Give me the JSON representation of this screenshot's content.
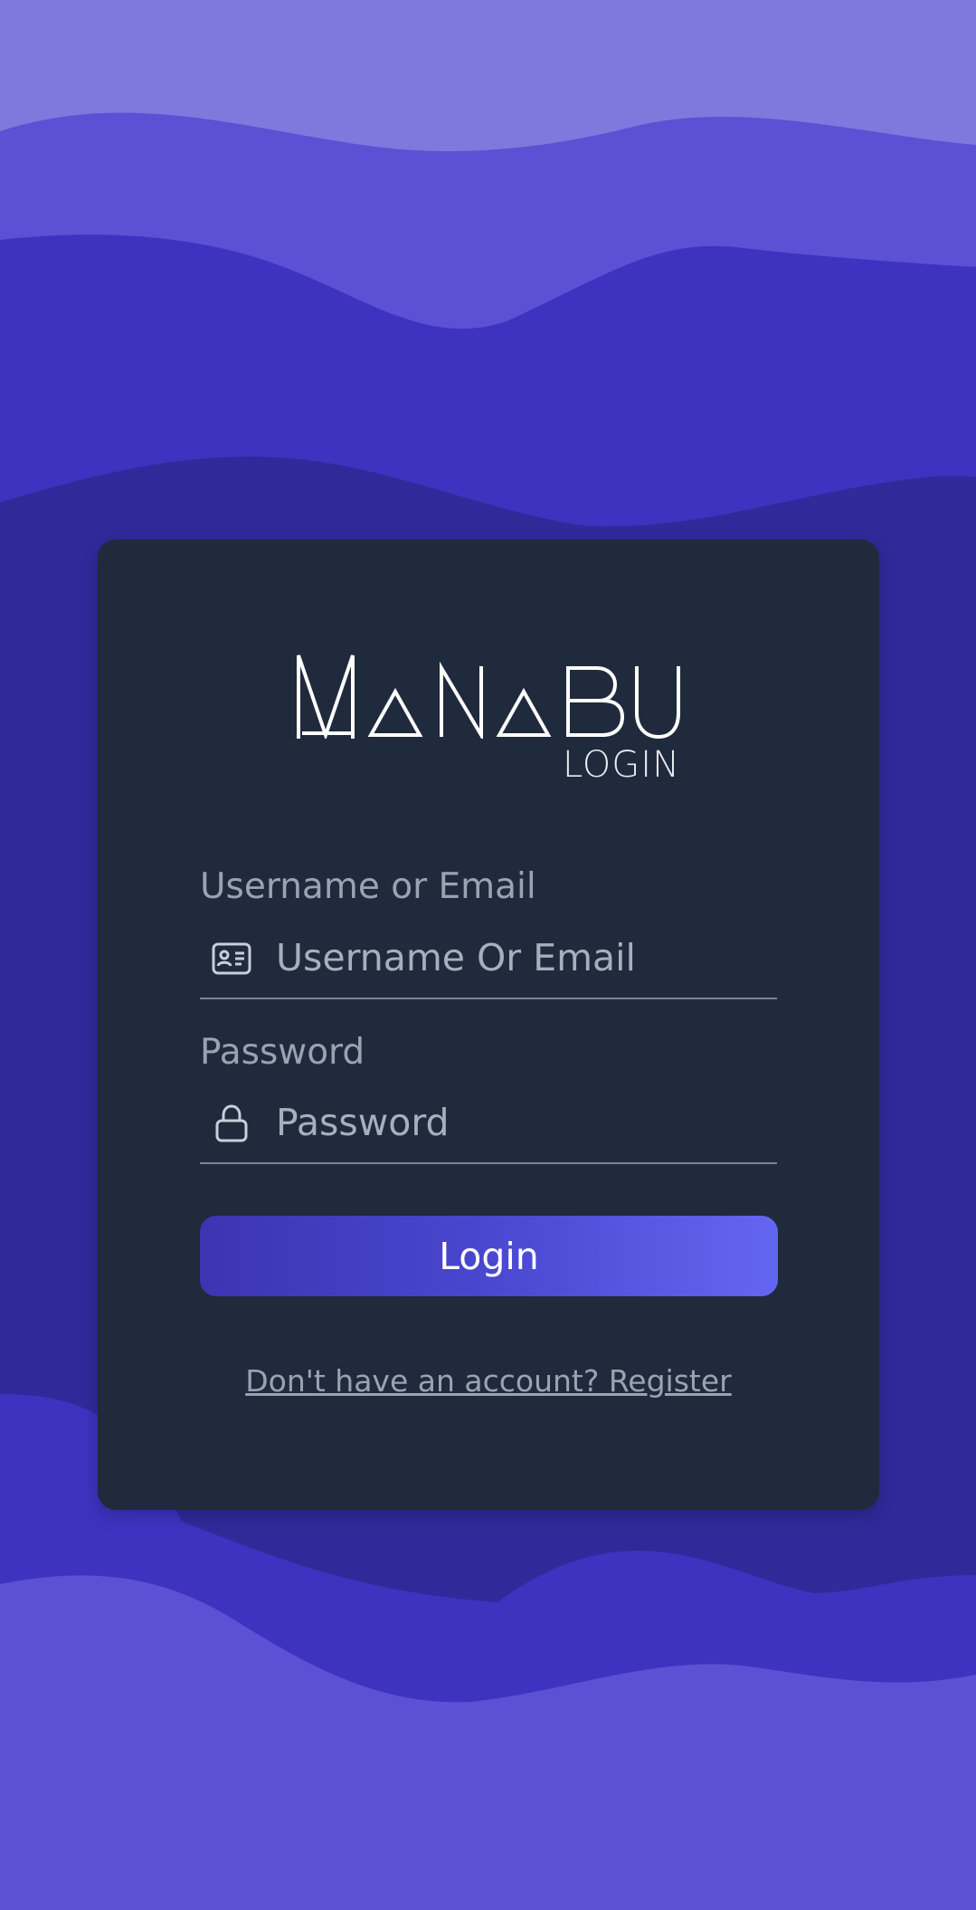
{
  "app": {
    "logo_text": "MANABU",
    "logo_subtitle": "LOGIN"
  },
  "form": {
    "username": {
      "label": "Username or Email",
      "placeholder": "Username Or Email",
      "value": "",
      "icon": "id-card-icon"
    },
    "password": {
      "label": "Password",
      "placeholder": "Password",
      "value": "",
      "icon": "lock-icon"
    },
    "submit_label": "Login",
    "register_link": "Don't have an account? Register"
  },
  "colors": {
    "background_wave_light": "#8079dd",
    "background_wave_mid": "#5c50d4",
    "background_wave_deep": "#3d33c0",
    "background_wave_darkest": "#2f2a9a",
    "card": "#1f2a3c",
    "button_gradient_start": "#3b35b2",
    "button_gradient_end": "#6366f1",
    "muted_text": "#9aa3b2"
  }
}
